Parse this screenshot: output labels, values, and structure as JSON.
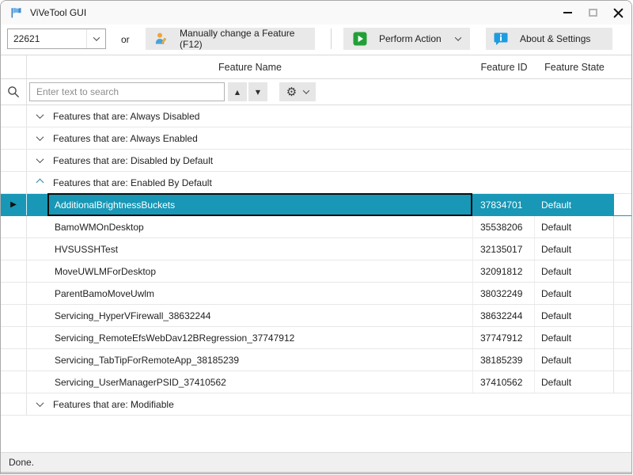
{
  "window": {
    "title": "ViVeTool GUI"
  },
  "toolbar": {
    "build_combo_value": "22621",
    "or_label": "or",
    "manual_feature_button": "Manually change a Feature (F12)",
    "perform_action_button": "Perform Action",
    "about_settings_button": "About & Settings"
  },
  "grid": {
    "columns": {
      "feature_name": "Feature Name",
      "feature_id": "Feature ID",
      "feature_state": "Feature State"
    },
    "search_placeholder": "Enter text to search",
    "icons": {
      "up": "▲",
      "down": "▼",
      "gear": "⚙",
      "row_selector": "▶"
    },
    "rows": [
      {
        "type": "group",
        "label": "Features that are: Always Disabled",
        "expanded": false
      },
      {
        "type": "group",
        "label": "Features that are: Always Enabled",
        "expanded": false
      },
      {
        "type": "group",
        "label": "Features that are: Disabled by Default",
        "expanded": false
      },
      {
        "type": "group",
        "label": "Features that are: Enabled By Default",
        "expanded": true
      },
      {
        "type": "feature",
        "name": "AdditionalBrightnessBuckets",
        "id": "37834701",
        "state": "Default",
        "selected": true
      },
      {
        "type": "feature",
        "name": "BamoWMOnDesktop",
        "id": "35538206",
        "state": "Default",
        "selected": false
      },
      {
        "type": "feature",
        "name": "HVSUSSHTest",
        "id": "32135017",
        "state": "Default",
        "selected": false
      },
      {
        "type": "feature",
        "name": "MoveUWLMForDesktop",
        "id": "32091812",
        "state": "Default",
        "selected": false
      },
      {
        "type": "feature",
        "name": "ParentBamoMoveUwlm",
        "id": "38032249",
        "state": "Default",
        "selected": false
      },
      {
        "type": "feature",
        "name": "Servicing_HyperVFirewall_38632244",
        "id": "38632244",
        "state": "Default",
        "selected": false
      },
      {
        "type": "feature",
        "name": "Servicing_RemoteEfsWebDav12BRegression_37747912",
        "id": "37747912",
        "state": "Default",
        "selected": false
      },
      {
        "type": "feature",
        "name": "Servicing_TabTipForRemoteApp_38185239",
        "id": "38185239",
        "state": "Default",
        "selected": false
      },
      {
        "type": "feature",
        "name": "Servicing_UserManagerPSID_37410562",
        "id": "37410562",
        "state": "Default",
        "selected": false
      },
      {
        "type": "group",
        "label": "Features that are: Modifiable",
        "expanded": false
      }
    ]
  },
  "statusbar": {
    "text": "Done."
  },
  "colors": {
    "selection_teal": "#1897b6",
    "play_green": "#22a038",
    "info_blue": "#1e9ce0",
    "expanded_chevron": "#2e86a6"
  }
}
